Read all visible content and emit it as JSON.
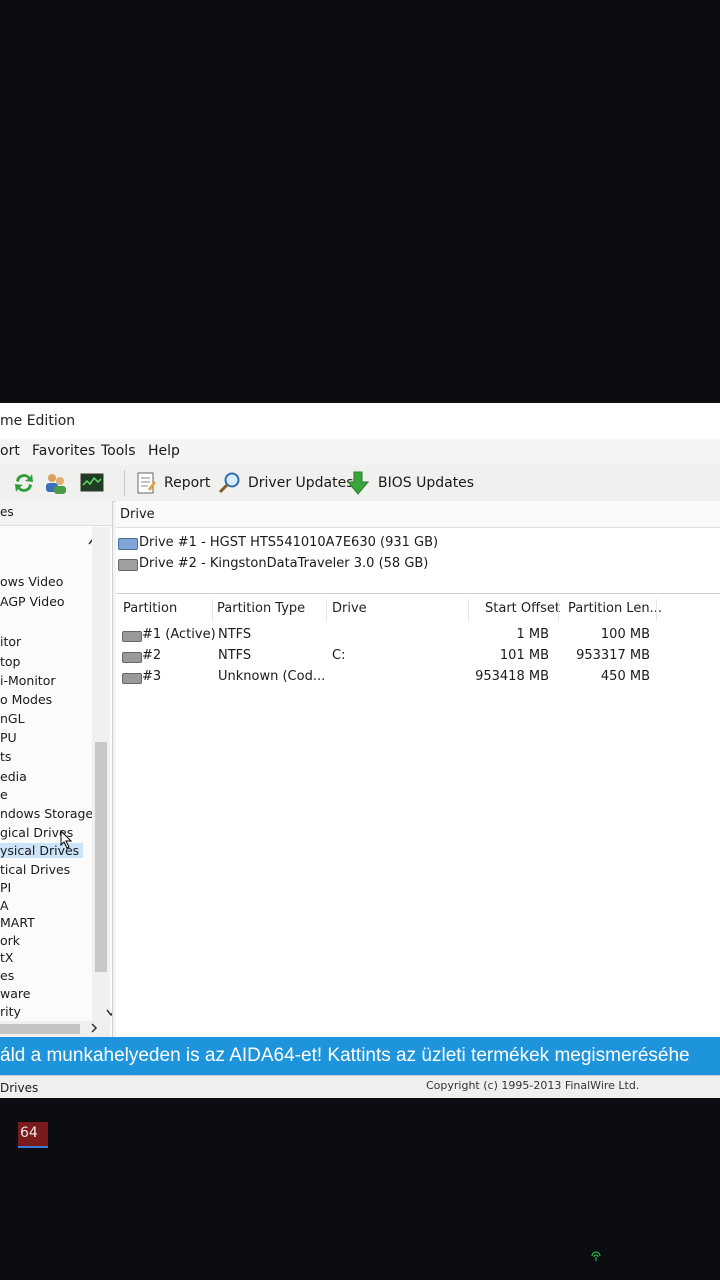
{
  "window": {
    "title_partial": "me Edition"
  },
  "menu": [
    "ort",
    "Favorites",
    "Tools",
    "Help"
  ],
  "toolbar": {
    "report": "Report",
    "driver_updates": "Driver Updates",
    "bios_updates": "BIOS Updates"
  },
  "sidebar": {
    "header": "es",
    "items": [
      {
        "label": "ows Video"
      },
      {
        "label": "AGP Video"
      },
      {
        "label": "itor"
      },
      {
        "label": "top"
      },
      {
        "label": "i-Monitor"
      },
      {
        "label": "o Modes"
      },
      {
        "label": "nGL"
      },
      {
        "label": "PU"
      },
      {
        "label": "ts"
      },
      {
        "label": "edia"
      },
      {
        "label": "e"
      },
      {
        "label": "ndows Storage"
      },
      {
        "label": "gical Drives"
      },
      {
        "label": "ysical Drives"
      },
      {
        "label": "tical Drives"
      },
      {
        "label": "PI"
      },
      {
        "label": "A"
      },
      {
        "label": "MART"
      },
      {
        "label": "ork"
      },
      {
        "label": "tX"
      },
      {
        "label": "es"
      },
      {
        "label": "ware"
      },
      {
        "label": "rity"
      }
    ],
    "selected_index": 13
  },
  "drives": {
    "header": "Drive",
    "items": [
      {
        "label": "Drive #1 - HGST HTS541010A7E630 (931 GB)"
      },
      {
        "label": "Drive #2 - KingstonDataTraveler 3.0 (58 GB)"
      }
    ]
  },
  "partitions": {
    "columns": [
      "Partition",
      "Partition Type",
      "Drive",
      "Start Offset",
      "Partition Len..."
    ],
    "rows": [
      {
        "partition": "#1 (Active)",
        "type": "NTFS",
        "drive": "",
        "start": "1 MB",
        "length": "100 MB"
      },
      {
        "partition": "#2",
        "type": "NTFS",
        "drive": "C:",
        "start": "101 MB",
        "length": "953317 MB"
      },
      {
        "partition": "#3",
        "type": "Unknown (Cod...",
        "drive": "",
        "start": "953418 MB",
        "length": "450 MB"
      }
    ]
  },
  "banner": {
    "text": "áld a munkahelyeden is az AIDA64-et! Kattints az üzleti termékek megismeréséhe"
  },
  "status": {
    "left": "Drives",
    "right": "Copyright (c) 1995-2013 FinalWire Ltd."
  },
  "taskbar": {
    "app_label": "64"
  },
  "colors": {
    "banner": "#1d94dc",
    "selection": "#cce4f7"
  }
}
